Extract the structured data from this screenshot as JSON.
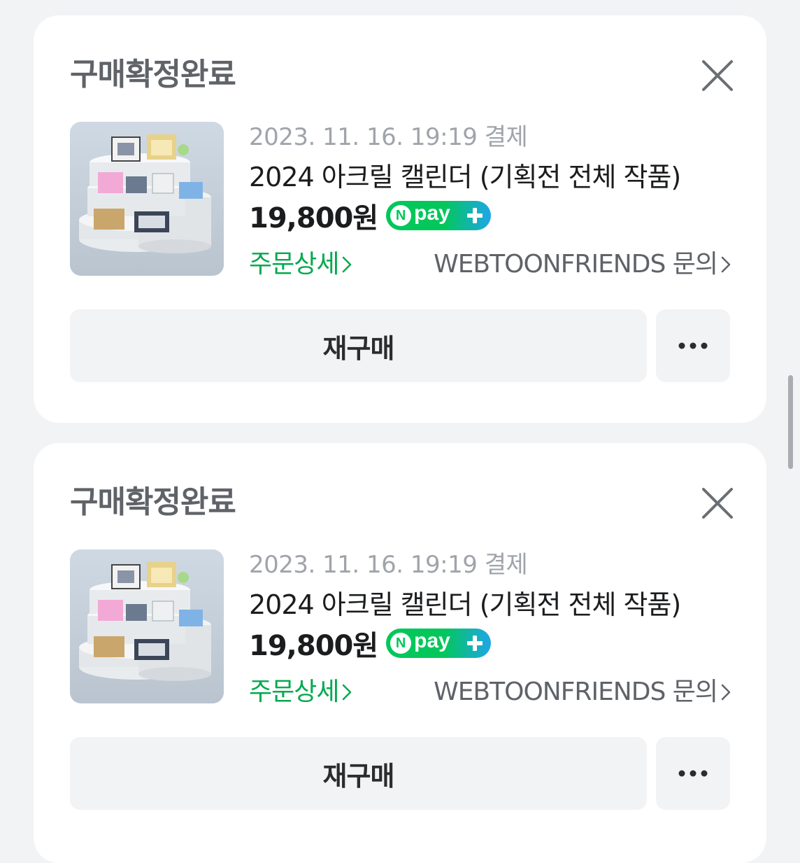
{
  "orders": [
    {
      "status": "구매확정완료",
      "date": "2023. 11. 16. 19:19 결제",
      "title": "2024 아크릴 캘린더 (기획전 전체 작품)",
      "price": "19,800원",
      "npay": {
        "n": "N",
        "label": "pay"
      },
      "detail_link": "주문상세",
      "inquiry_link": "WEBTOONFRIENDS 문의",
      "rebuy_label": "재구매"
    },
    {
      "status": "구매확정완료",
      "date": "2023. 11. 16. 19:19 결제",
      "title": "2024 아크릴 캘린더 (기획전 전체 작품)",
      "price": "19,800원",
      "npay": {
        "n": "N",
        "label": "pay"
      },
      "detail_link": "주문상세",
      "inquiry_link": "WEBTOONFRIENDS 문의",
      "rebuy_label": "재구매"
    }
  ],
  "icons": {
    "close": "close-icon",
    "more": "more-dots-icon",
    "chevron": "chevron-right-icon",
    "npay_plus": "plus-icon"
  },
  "colors": {
    "background": "#f2f3f5",
    "card": "#ffffff",
    "accent_green": "#03a94f",
    "npay_green": "#03c75a",
    "npay_blue": "#1fa6e8",
    "status_text": "#5f6368",
    "muted_text": "#a0a4aa"
  }
}
